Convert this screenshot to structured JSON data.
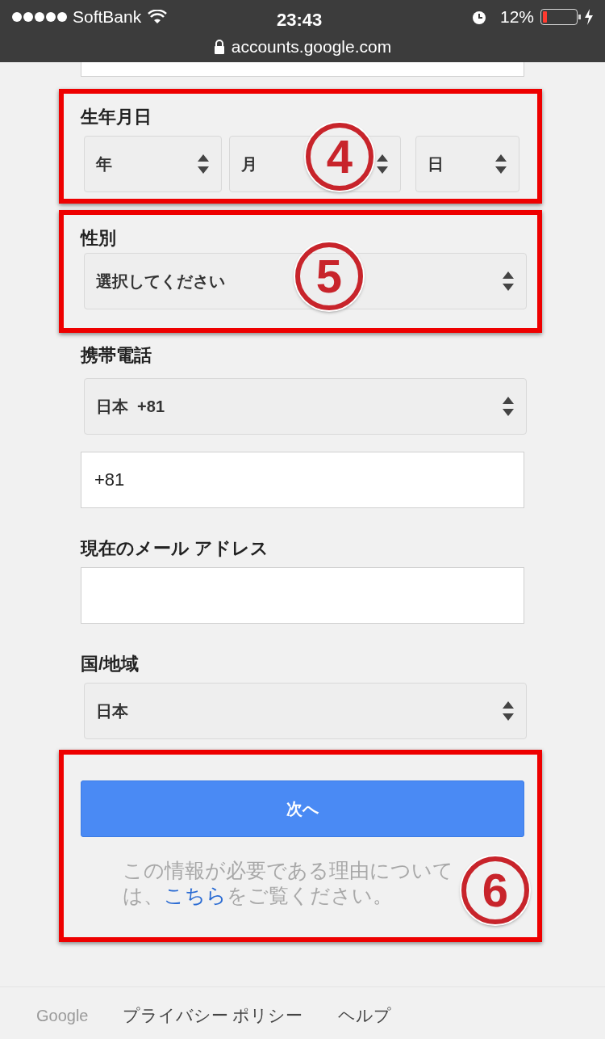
{
  "status_bar": {
    "carrier": "SoftBank",
    "time": "23:43",
    "battery": {
      "text": "12%",
      "level": 0.12
    },
    "url": "accounts.google.com"
  },
  "birthday": {
    "annotation": "4",
    "label": "生年月日",
    "selects": [
      {
        "value": "年",
        "kind": "year"
      },
      {
        "value": "月",
        "kind": "month"
      },
      {
        "value": "日",
        "kind": "day"
      }
    ]
  },
  "gender": {
    "annotation": "5",
    "label": "性別",
    "select": "選択してください"
  },
  "phone": {
    "label": "携帯電話",
    "country_select": "日本  +81",
    "number_value": "+81"
  },
  "email": {
    "label": "現在のメール アドレス"
  },
  "region": {
    "label": "国/地域",
    "select": "日本"
  },
  "submit": {
    "annotation": "6",
    "next_button": "次へ",
    "help_text": {
      "before": "この情報が必要である理由については、",
      "link": "こちら",
      "after": "をご覧ください。"
    }
  },
  "footer": {
    "links": [
      "Google",
      "プライバシー ポリシー",
      "ヘルプ"
    ]
  }
}
